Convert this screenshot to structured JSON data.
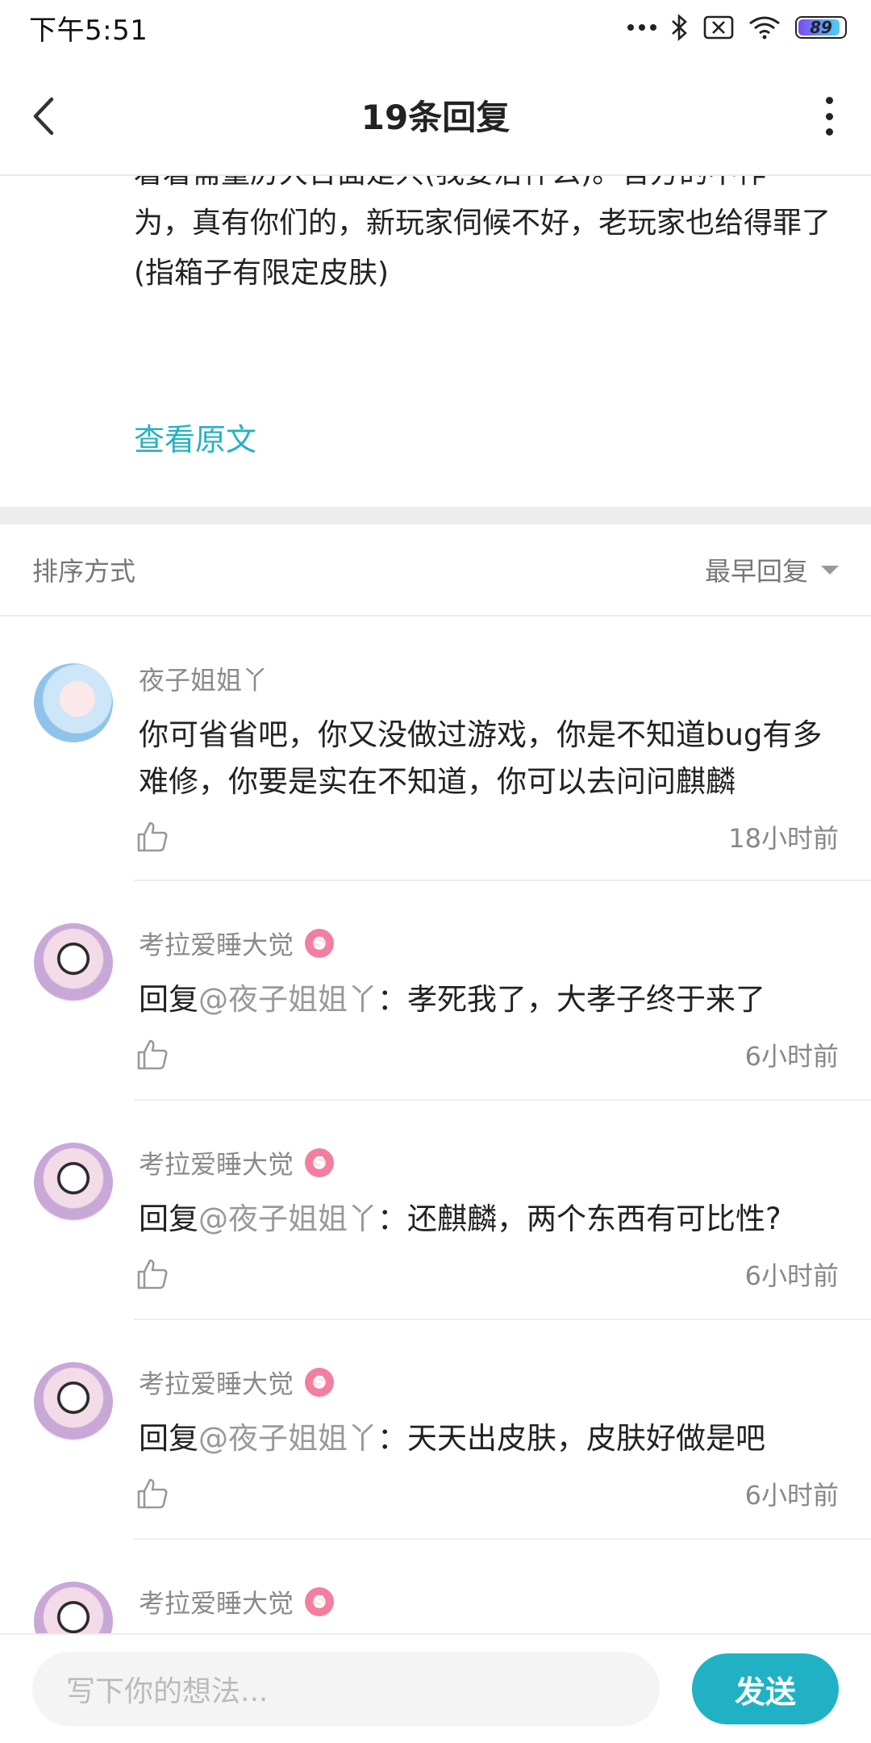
{
  "status_bar": {
    "time": "下午5:51",
    "battery": "89",
    "icons": [
      "more-dots-icon",
      "bluetooth-icon",
      "no-sim-icon",
      "wifi-icon",
      "battery-icon"
    ]
  },
  "header": {
    "title": "19条回复",
    "back_icon": "chevron-left-icon",
    "more_icon": "more-vertical-icon"
  },
  "post": {
    "cut_line": "着着需量厉大台面是只(我要治什么)。官方的不作",
    "text": "为，真有你们的，新玩家伺候不好，老玩家也给得罪了(指箱子有限定皮肤)",
    "view_original": "查看原文"
  },
  "sort": {
    "label": "排序方式",
    "value": "最早回复"
  },
  "comments": [
    {
      "username": "夜子姐姐丫",
      "content": "你可省省吧，你又没做过游戏，你是不知道bug有多难修，你要是实在不知道，你可以去问问麒麟",
      "time": "18小时前"
    },
    {
      "username": "考拉爱睡大觉",
      "reply_prefix": "回复",
      "mention": "@夜子姐姐丫",
      "content": "：孝死我了，大孝子终于来了",
      "time": "6小时前"
    },
    {
      "username": "考拉爱睡大觉",
      "reply_prefix": "回复",
      "mention": "@夜子姐姐丫",
      "content": "：还麒麟，两个东西有可比性?",
      "time": "6小时前"
    },
    {
      "username": "考拉爱睡大觉",
      "reply_prefix": "回复",
      "mention": "@夜子姐姐丫",
      "content": "：天天出皮肤，皮肤好做是吧",
      "time": "6小时前"
    },
    {
      "username": "考拉爱睡大觉"
    }
  ],
  "input": {
    "placeholder": "写下你的想法...",
    "send_label": "发送"
  },
  "colors": {
    "accent": "#20b2c4",
    "link": "#26b1c2",
    "badge": "#f27fa0"
  }
}
